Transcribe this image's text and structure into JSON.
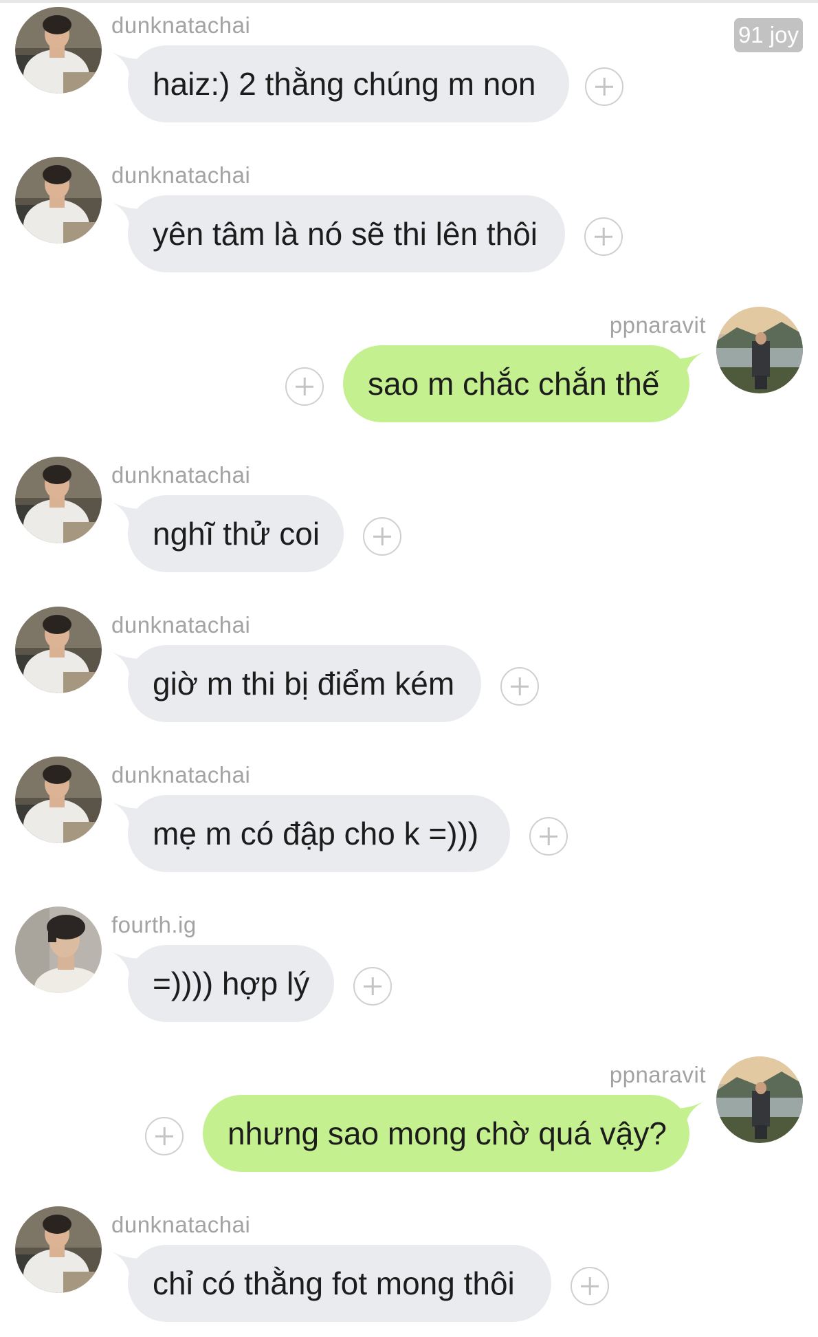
{
  "chat": {
    "read_counter": "91 joy",
    "messages": [
      {
        "sender": "dunknatachai",
        "text": "haiz:) 2 thằng chúng m non",
        "side": "in"
      },
      {
        "sender": "dunknatachai",
        "text": "yên tâm là nó sẽ thi lên thôi",
        "side": "in"
      },
      {
        "sender": "ppnaravit",
        "text": "sao m chắc chắn thế",
        "side": "out"
      },
      {
        "sender": "dunknatachai",
        "text": "nghĩ thử coi",
        "side": "in"
      },
      {
        "sender": "dunknatachai",
        "text": "giờ m thi bị điểm kém",
        "side": "in"
      },
      {
        "sender": "dunknatachai",
        "text": "mẹ m có đập cho k =)))",
        "side": "in"
      },
      {
        "sender": "fourth.ig",
        "text": "=)))) hợp lý",
        "side": "in"
      },
      {
        "sender": "ppnaravit",
        "text": "nhưng sao mong chờ quá vậy?",
        "side": "out"
      },
      {
        "sender": "dunknatachai",
        "text": "chỉ có thằng fot mong thôi",
        "side": "in"
      }
    ]
  },
  "colors": {
    "incoming_bubble": "#e9ebee",
    "outgoing_bubble": "#c4f08f",
    "sender_name": "#a3a3a3",
    "plus_icon": "#cfcfcf"
  },
  "icons": {
    "react": "plus-circle-icon",
    "avatar_dunknatachai": "avatar-photo-dunknatachai",
    "avatar_ppnaravit": "avatar-photo-ppnaravit",
    "avatar_fourth": "avatar-photo-fourth"
  }
}
